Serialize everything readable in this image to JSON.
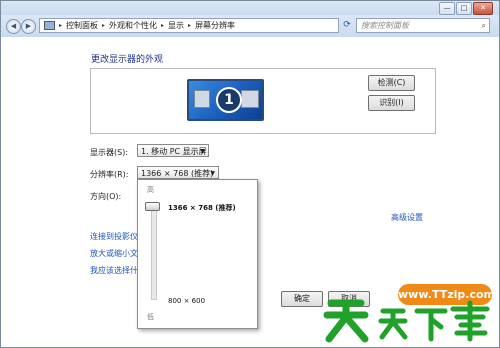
{
  "window": {
    "controls": [
      "—",
      "□",
      "✕"
    ]
  },
  "address": {
    "segments": [
      "控制面板",
      "外观和个性化",
      "显示",
      "屏幕分辨率"
    ],
    "separator": "▸",
    "search_placeholder": "搜索控制面板"
  },
  "page": {
    "title": "更改显示器的外观",
    "monitor_number": "1",
    "detect_button": "检测(C)",
    "identify_button": "识别(I)",
    "display_label": "显示器(S):",
    "display_value": "1. 移动 PC 显示屏",
    "resolution_label": "分辨率(R):",
    "resolution_value": "1366 × 768 (推荐)",
    "orientation_label": "方向(O):",
    "advanced_link": "高级设置",
    "links": [
      "连接到投影仪 (",
      "放大或缩小文本",
      "我应该选择什么"
    ],
    "ok_button": "确定",
    "cancel_button": "取消"
  },
  "resolution_popup": {
    "high_label": "高",
    "low_label": "低",
    "top_option": "1366 × 768 (推荐)",
    "bottom_option": "800 × 600",
    "slider_level": 1.0
  },
  "watermark": {
    "url": "www.TTzip.com",
    "logo_text": "天天下载",
    "color": "#1fa12a"
  },
  "colors": {
    "link": "#1a57b8",
    "title": "#1e3287",
    "accent": "#f08a16"
  }
}
